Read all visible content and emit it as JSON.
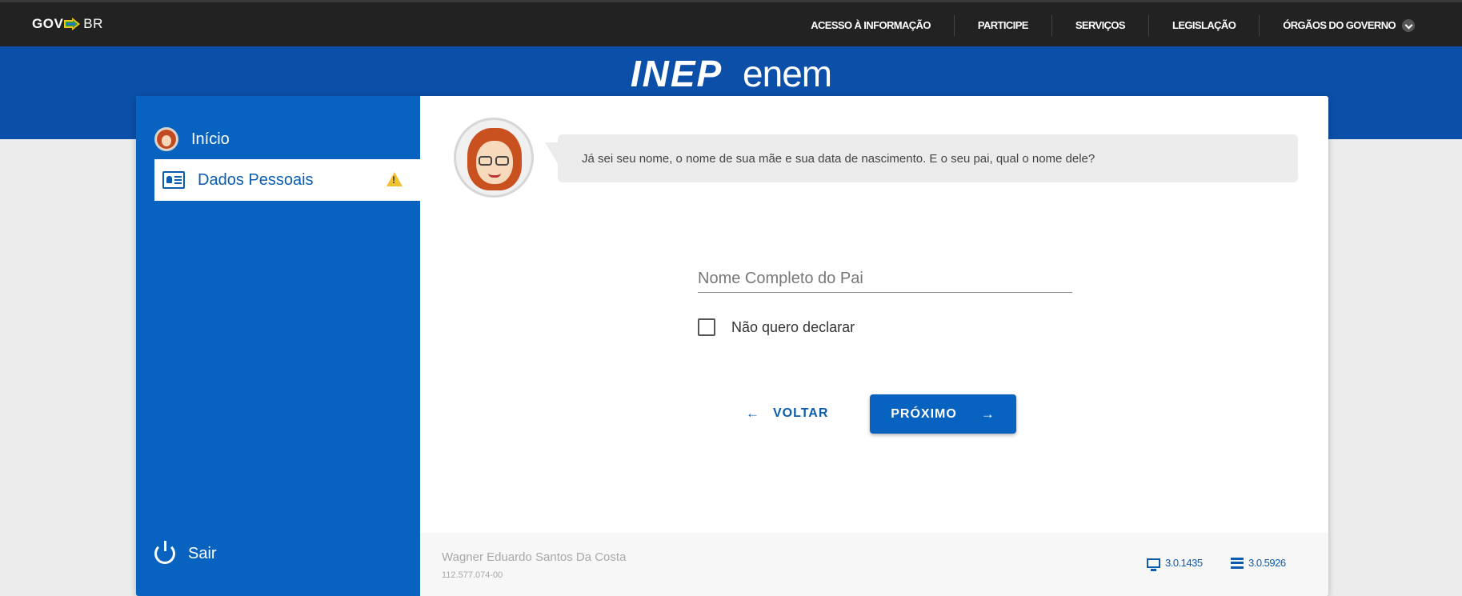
{
  "gov": {
    "logo_gov": "GOV",
    "logo_br": "BR",
    "nav": [
      "ACESSO À INFORMAÇÃO",
      "PARTICIPE",
      "SERVIÇOS",
      "LEGISLAÇÃO",
      "ÓRGÃOS DO GOVERNO"
    ]
  },
  "brand": {
    "inep": "INEP",
    "enem": "enem"
  },
  "sidebar": {
    "home_label": "Início",
    "dados_label": "Dados Pessoais",
    "logout_label": "Sair"
  },
  "main": {
    "bubble_text": "Já sei seu nome, o nome de sua mãe e sua data de nascimento. E o seu pai, qual o nome dele?",
    "father_placeholder": "Nome Completo do Pai",
    "father_value": "",
    "checkbox_label": "Não quero declarar",
    "checkbox_checked": false,
    "back_label": "VOLTAR",
    "next_label": "PRÓXIMO"
  },
  "footer": {
    "user_name": "Wagner Eduardo Santos Da Costa",
    "user_id": "112.577.074-00",
    "client_version": "3.0.1435",
    "server_version": "3.0.5926"
  },
  "colors": {
    "primary": "#0862bf",
    "header_blue": "#0b4fa8",
    "gov_bar": "#222222",
    "warning": "#f2c131"
  }
}
